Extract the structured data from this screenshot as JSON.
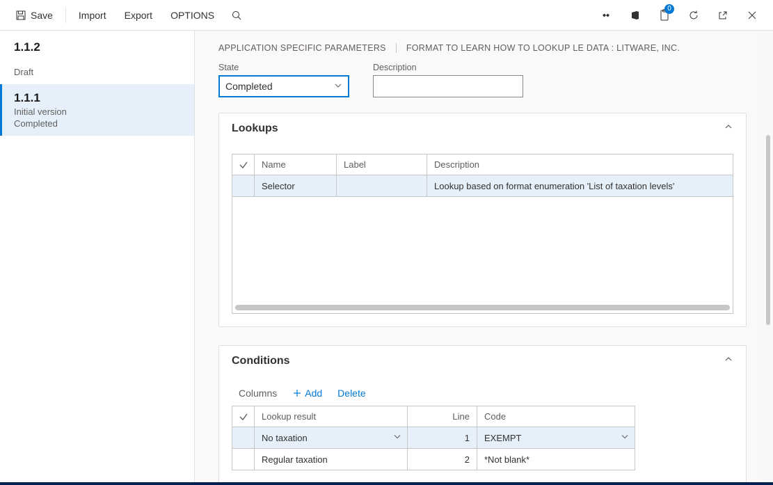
{
  "toolbar": {
    "save": "Save",
    "import": "Import",
    "export": "Export",
    "options": "OPTIONS",
    "notifications_count": "0"
  },
  "versions": [
    {
      "number": "1.1.2",
      "subtitle1": "",
      "subtitle2": "Draft",
      "selected": false
    },
    {
      "number": "1.1.1",
      "subtitle1": "Initial version",
      "subtitle2": "Completed",
      "selected": true
    }
  ],
  "breadcrumb": {
    "a": "APPLICATION SPECIFIC PARAMETERS",
    "b": "FORMAT TO LEARN HOW TO LOOKUP LE DATA : LITWARE, INC."
  },
  "fields": {
    "state_label": "State",
    "state_value": "Completed",
    "description_label": "Description",
    "description_value": ""
  },
  "lookups": {
    "title": "Lookups",
    "cols": {
      "name": "Name",
      "label": "Label",
      "desc": "Description"
    },
    "rows": [
      {
        "name": "Selector",
        "label": "",
        "desc": "Lookup based on format enumeration 'List of taxation levels'"
      }
    ]
  },
  "conditions": {
    "title": "Conditions",
    "toolbar": {
      "columns": "Columns",
      "add": "Add",
      "delete": "Delete"
    },
    "cols": {
      "result": "Lookup result",
      "line": "Line",
      "code": "Code"
    },
    "rows": [
      {
        "result": "No taxation",
        "line": "1",
        "code": "EXEMPT"
      },
      {
        "result": "Regular taxation",
        "line": "2",
        "code": "*Not blank*"
      }
    ]
  }
}
